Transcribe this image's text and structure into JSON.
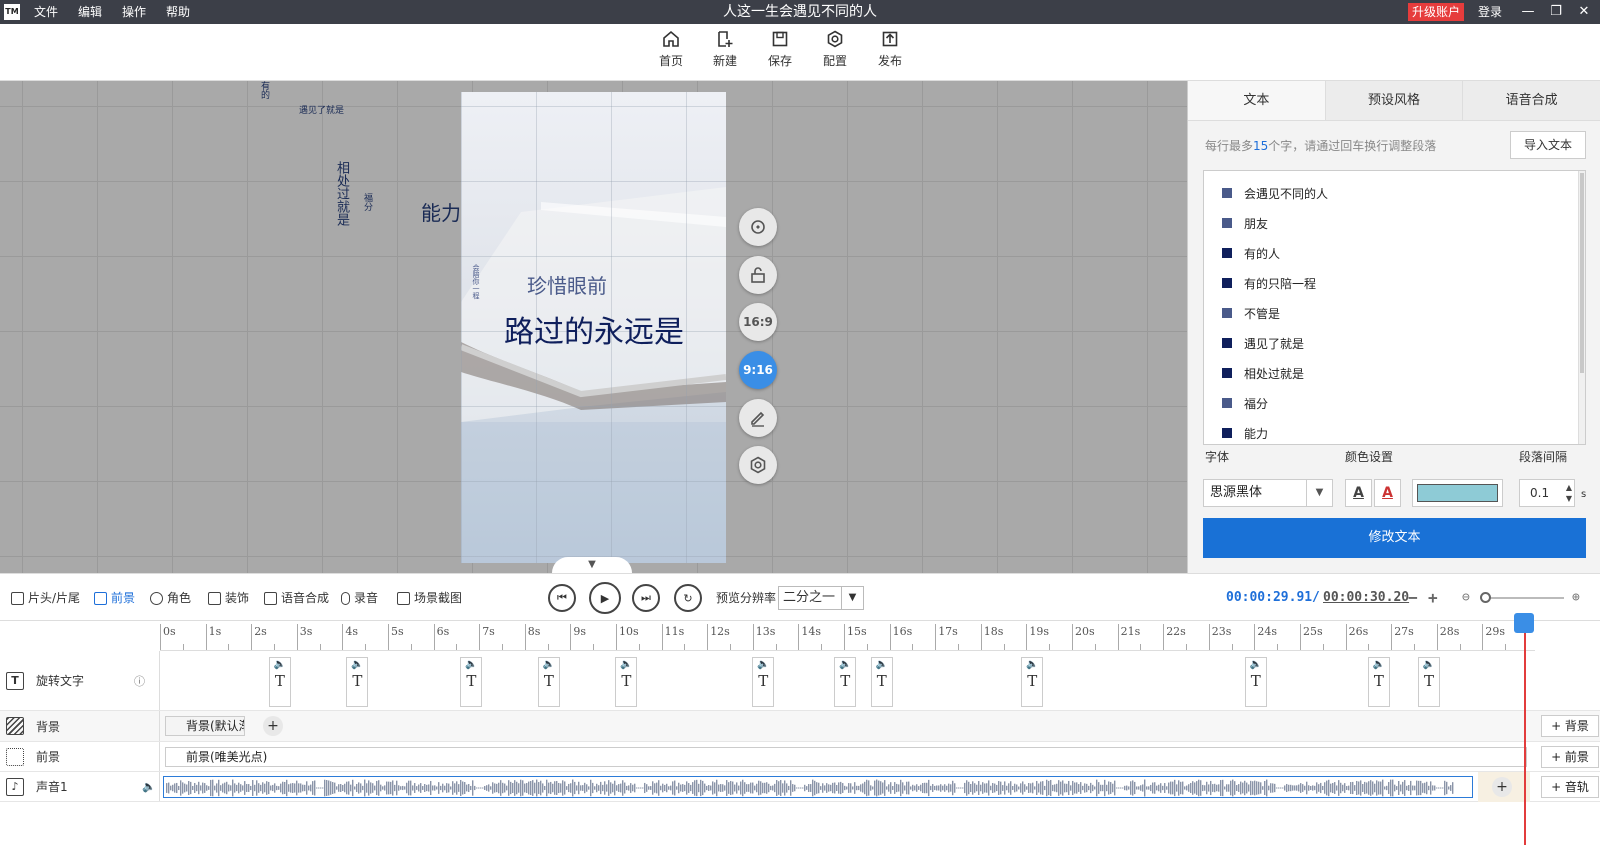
{
  "titlebar": {
    "logo": "TM",
    "menu": [
      "文件",
      "编辑",
      "操作",
      "帮助"
    ],
    "title": "人这一生会遇见不同的人",
    "upgrade": "升级账户",
    "login": "登录"
  },
  "toolbar": {
    "home": "首页",
    "new": "新建",
    "save": "保存",
    "config": "配置",
    "publish": "发布"
  },
  "canvas": {
    "float_texts": [
      "有的",
      "遇见了就是",
      "相处过就是",
      "福分",
      "能力"
    ],
    "preview_texts": {
      "line1": "珍惜眼前",
      "line2": "路过的永远是",
      "small_vertical": "会陪你一程"
    },
    "side_buttons": {
      "ratio169": "16:9",
      "ratio916": "9:16"
    }
  },
  "right_panel": {
    "tabs": [
      "文本",
      "预设风格",
      "语音合成"
    ],
    "hint_prefix": "每行最多",
    "hint_num": "15",
    "hint_suffix": "个字，请通过回车换行调整段落",
    "import_label": "导入文本",
    "texts": [
      {
        "label": "会遇见不同的人",
        "color": "#4a5a8a"
      },
      {
        "label": "朋友",
        "color": "#4a5a8a"
      },
      {
        "label": "有的人",
        "color": "#0f1f5c"
      },
      {
        "label": "有的只陪一程",
        "color": "#0f1f5c"
      },
      {
        "label": "不管是",
        "color": "#4a5a8a"
      },
      {
        "label": "遇见了就是",
        "color": "#0f1f5c"
      },
      {
        "label": "相处过就是",
        "color": "#0f1f5c"
      },
      {
        "label": "福分",
        "color": "#4a5a8a"
      },
      {
        "label": "能力",
        "color": "#0f1f5c"
      }
    ],
    "font_label": "字体",
    "font_value": "思源黑体",
    "color_label": "颜色设置",
    "color_value": "#8ecbd6",
    "spacing_label": "段落间隔",
    "spacing_value": "0.1",
    "spacing_unit": "s",
    "modify_label": "修改文本"
  },
  "bottom_bar": {
    "items": [
      "片头/片尾",
      "前景",
      "角色",
      "装饰",
      "语音合成",
      "录音",
      "场景截图"
    ],
    "res_label": "预览分辨率",
    "res_value": "二分之一",
    "time_current": "00:00:29.91",
    "time_sep": "/",
    "time_total": "00:00:30.20",
    "minus": "−",
    "plus": "+"
  },
  "timeline": {
    "ruler": [
      "0s",
      "1s",
      "2s",
      "3s",
      "4s",
      "5s",
      "6s",
      "7s",
      "8s",
      "9s",
      "10s",
      "11s",
      "12s",
      "13s",
      "14s",
      "15s",
      "16s",
      "17s",
      "18s",
      "19s",
      "20s",
      "21s",
      "22s",
      "23s",
      "24s",
      "25s",
      "26s",
      "27s",
      "28s",
      "29s"
    ],
    "tracks": {
      "rotate_text": "旋转文字",
      "background": "背景",
      "foreground": "前景",
      "audio": "声音1"
    },
    "bg_clip": "背景(默认渐",
    "fg_clip": "前景(唯美光点)",
    "add_bg": "+ 背景",
    "add_fg": "+ 前景",
    "add_audio": "+ 音轨",
    "text_marks": [
      2.3,
      4.0,
      6.5,
      8.2,
      9.9,
      12.9,
      14.7,
      15.5,
      18.8,
      23.7,
      26.4,
      27.5
    ]
  }
}
